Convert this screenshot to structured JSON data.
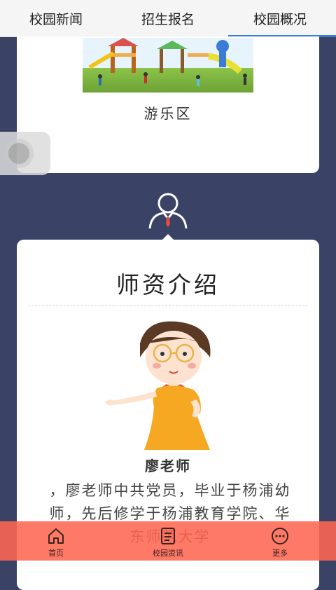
{
  "tabs": [
    {
      "label": "校园新闻"
    },
    {
      "label": "招生报名"
    },
    {
      "label": "校园概况"
    }
  ],
  "active_tab_index": 2,
  "colors": {
    "background": "#3a4266",
    "tab_active_underline": "#3a7bd5",
    "bottom_nav": "#ff6652"
  },
  "playground_card": {
    "image_icon": "playground-image",
    "label": "游乐区"
  },
  "teacher_section": {
    "section_icon": "teacher-icon",
    "title": "师资介绍",
    "teacher_name": "廖老师",
    "description": "，廖老师中共党员，毕业于杨浦幼师，先后修学于杨浦教育学院、华东师范大学"
  },
  "bottom_nav": {
    "items": [
      {
        "label": "首页",
        "icon": "home-icon"
      },
      {
        "label": "校园资讯",
        "icon": "document-icon"
      },
      {
        "label": "更多",
        "icon": "more-icon"
      }
    ]
  }
}
